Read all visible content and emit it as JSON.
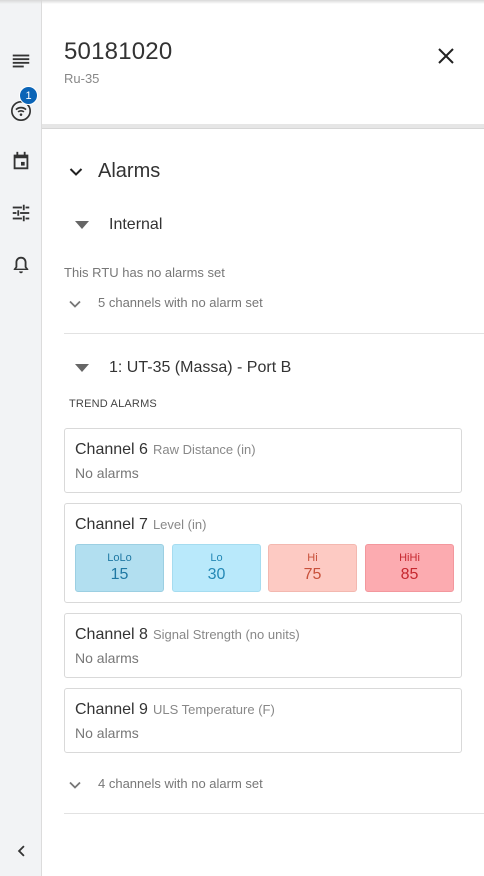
{
  "rail": {
    "notification_count": "1",
    "icons": [
      "menu-icon",
      "wifi-icon",
      "calendar-icon",
      "tune-icon",
      "bell-icon",
      "chevron-left-icon"
    ]
  },
  "header": {
    "title": "50181020",
    "subtitle": "Ru-35"
  },
  "alarms": {
    "title": "Alarms",
    "internal": {
      "title": "Internal",
      "message": "This RTU has no alarms set",
      "no_alarm_channels": "5 channels with no alarm set"
    },
    "device": {
      "title": "1: UT-35 (Massa) - Port B",
      "trend_label": "TREND ALARMS",
      "channels": [
        {
          "name": "Channel 6",
          "unit": "Raw Distance (in)",
          "status": "No alarms"
        },
        {
          "name": "Channel 7",
          "unit": "Level (in)",
          "thresholds": [
            {
              "label": "LoLo",
              "value": "15"
            },
            {
              "label": "Lo",
              "value": "30"
            },
            {
              "label": "Hi",
              "value": "75"
            },
            {
              "label": "HiHi",
              "value": "85"
            }
          ]
        },
        {
          "name": "Channel 8",
          "unit": "Signal Strength (no units)",
          "status": "No alarms"
        },
        {
          "name": "Channel 9",
          "unit": "ULS Temperature (F)",
          "status": "No alarms"
        }
      ],
      "no_alarm_channels": "4 channels with no alarm set"
    }
  },
  "colors": {
    "accent": "#0b64b7",
    "lolo": "#b2dff0",
    "lo": "#b9e9fb",
    "hi": "#fdcac3",
    "hihi": "#fcabb0"
  }
}
